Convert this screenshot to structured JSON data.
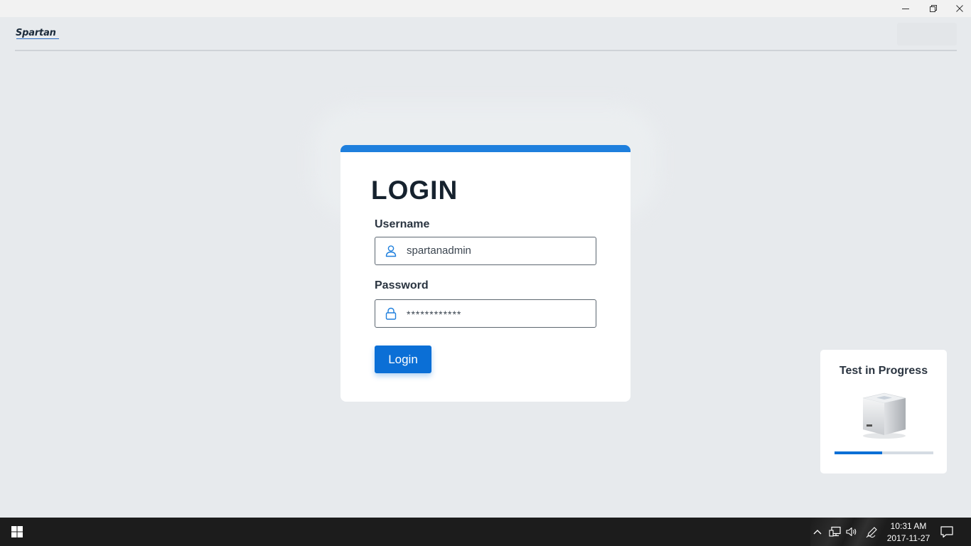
{
  "window": {
    "controls": [
      "minimize-icon",
      "restore-icon",
      "close-icon"
    ]
  },
  "header": {
    "logo_text": "Spartan"
  },
  "login": {
    "title": "LOGIN",
    "username_label": "Username",
    "username_value": "spartanadmin",
    "password_label": "Password",
    "password_value": "************",
    "button_label": "Login",
    "accent_color": "#1e7fdd",
    "button_color": "#0b6fd6"
  },
  "progress": {
    "title": "Test in Progress",
    "progress_fraction": 0.48
  },
  "taskbar": {
    "time": "10:31 AM",
    "date": "2017-11-27",
    "tray_icons": [
      "chevron-up-icon",
      "network-icon",
      "volume-icon",
      "pen-icon"
    ]
  }
}
